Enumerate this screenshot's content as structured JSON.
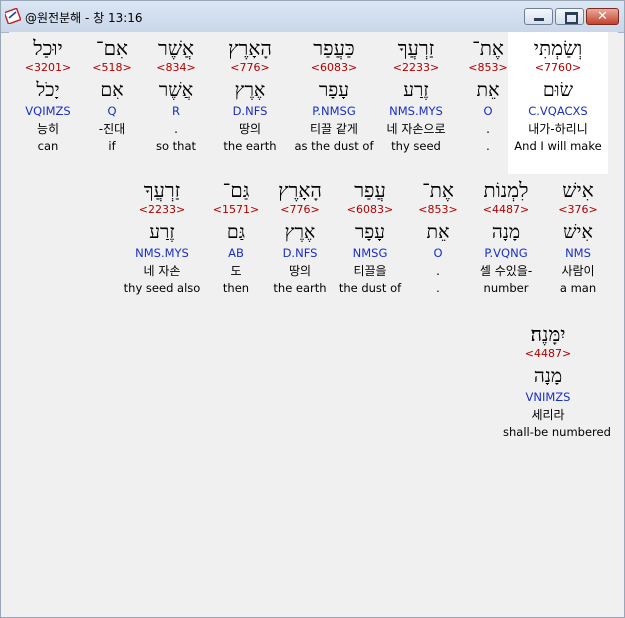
{
  "window": {
    "title": "@원전분해 - 창 13:16",
    "minimize_label": "minimize",
    "maximize_label": "maximize",
    "close_label": "✕"
  },
  "words": [
    {
      "heb1": "וְשַׂמְתִּי",
      "strong": "<7760>",
      "heb2": "שׂוּם",
      "morph": "C.VQACXS",
      "kor": "내가-하리니",
      "eng": "And I will make",
      "highlight": true
    },
    {
      "heb1": "אֶת־",
      "strong": "<853>",
      "heb2": "אֵת",
      "morph": "O",
      "kor": ".",
      "eng": "."
    },
    {
      "heb1": "זַרְעֲךָ",
      "strong": "<2233>",
      "heb2": "זֶרַע",
      "morph": "NMS.MYS",
      "kor": "네 자손으로",
      "eng": "thy seed"
    },
    {
      "heb1": "כַּעֲפַר",
      "strong": "<6083>",
      "heb2": "עָפָר",
      "morph": "P.NMSG",
      "kor": "티끌 같게",
      "eng": "as the dust of"
    },
    {
      "heb1": "הָאָרֶץ",
      "strong": "<776>",
      "heb2": "אֶרֶץ",
      "morph": "D.NFS",
      "kor": "땅의",
      "eng": "the earth"
    },
    {
      "heb1": "אֲשֶׁר",
      "strong": "<834>",
      "heb2": "אֲשֶׁר",
      "morph": "R",
      "kor": ".",
      "eng": "so that"
    },
    {
      "heb1": "אִם־",
      "strong": "<518>",
      "heb2": "אִם",
      "morph": "Q",
      "kor": "-진대",
      "eng": "if"
    },
    {
      "heb1": "יוּכַל",
      "strong": "<3201>",
      "heb2": "יָכֹל",
      "morph": "VQIMZS",
      "kor": "능히",
      "eng": "can"
    },
    {
      "heb1": "אִישׁ",
      "strong": "<376>",
      "heb2": "אִישׁ",
      "morph": "NMS",
      "kor": "사람이",
      "eng": "a man"
    },
    {
      "heb1": "לִמְנוֹת",
      "strong": "<4487>",
      "heb2": "מָנָה",
      "morph": "P.VQNG",
      "kor": "셀 수있을-",
      "eng": "number"
    },
    {
      "heb1": "אֶת־",
      "strong": "<853>",
      "heb2": "אֵת",
      "morph": "O",
      "kor": ".",
      "eng": "."
    },
    {
      "heb1": "עֲפַר",
      "strong": "<6083>",
      "heb2": "עָפָר",
      "morph": "NMSG",
      "kor": "티끌을",
      "eng": "the dust of"
    },
    {
      "heb1": "הָאָרֶץ",
      "strong": "<776>",
      "heb2": "אֶרֶץ",
      "morph": "D.NFS",
      "kor": "땅의",
      "eng": "the earth"
    },
    {
      "heb1": "גַּם־",
      "strong": "<1571>",
      "heb2": "גַּם",
      "morph": "AB",
      "kor": "도",
      "eng": "then"
    },
    {
      "heb1": "זַרְעֲךָ",
      "strong": "<2233>",
      "heb2": "זֶרַע",
      "morph": "NMS.MYS",
      "kor": "네 자손",
      "eng": "thy seed also"
    },
    {
      "heb1": "יִמָּנֶה׃",
      "strong": "<4487>",
      "heb2": "מָנָה",
      "morph": "VNIMZS",
      "kor": "세리라",
      "eng": "shall-be numbered"
    }
  ]
}
